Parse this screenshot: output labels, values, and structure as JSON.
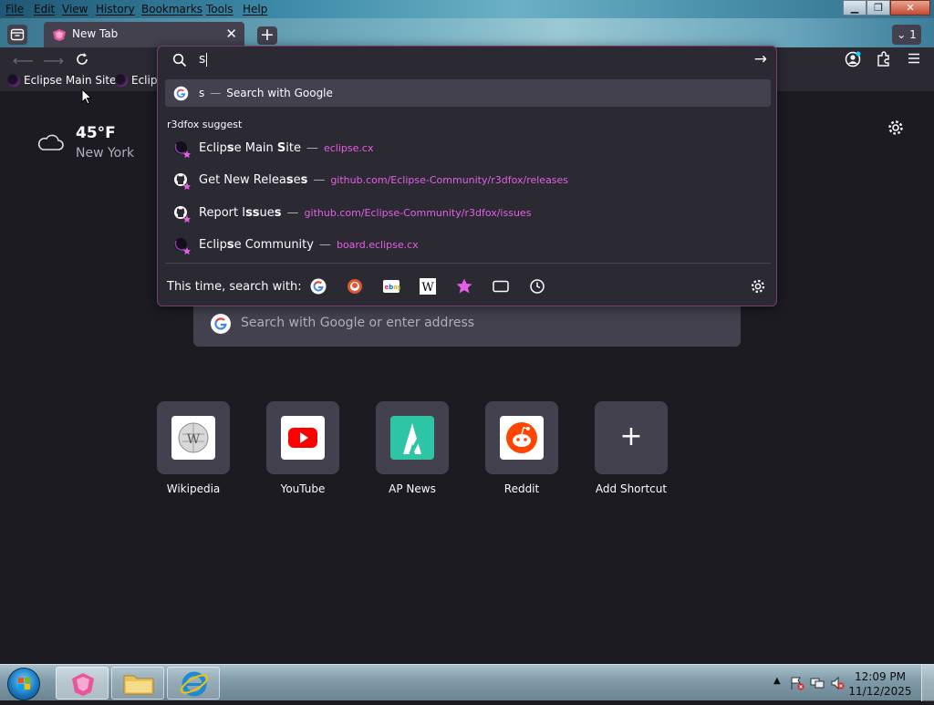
{
  "menu": [
    "File",
    "Edit",
    "View",
    "History",
    "Bookmarks",
    "Tools",
    "Help"
  ],
  "window_controls": {
    "minimize": "▁",
    "restore": "❐",
    "close": "✕"
  },
  "tab": {
    "title": "New Tab",
    "close": "✕"
  },
  "new_tab_label": "+",
  "tab_count": "1",
  "bookmarks": [
    "Eclipse Main Site",
    "Eclips"
  ],
  "weather": {
    "temp": "45°F",
    "location": "New York"
  },
  "search_placeholder": "Search with Google or enter address",
  "shortcuts": [
    {
      "label": "Wikipedia",
      "icon": "wikipedia-icon"
    },
    {
      "label": "YouTube",
      "icon": "youtube-icon"
    },
    {
      "label": "AP News",
      "icon": "apnews-icon"
    },
    {
      "label": "Reddit",
      "icon": "reddit-icon"
    },
    {
      "label": "Add Shortcut",
      "icon": "plus-icon",
      "glyph": "+"
    }
  ],
  "popup": {
    "query": "s",
    "search_row": {
      "query": "s",
      "sep": "—",
      "text": "Search with Google"
    },
    "suggest_heading": "r3dfox suggest",
    "results": [
      {
        "title_pre": "Eclip",
        "title_bold": "s",
        "title_post": "e Main ",
        "title_bold2": "S",
        "title_post2": "ite",
        "sep": "—",
        "url": "eclipse.cx",
        "icon": "eclipse-icon"
      },
      {
        "title_pre": "Get New Relea",
        "title_bold": "s",
        "title_post": "e",
        "title_bold2": "s",
        "title_post2": "",
        "sep": "—",
        "url": "github.com/Eclipse-Community/r3dfox/releases",
        "icon": "github-icon"
      },
      {
        "title_pre": "Report I",
        "title_bold": "ss",
        "title_post": "ue",
        "title_bold2": "s",
        "title_post2": "",
        "sep": "—",
        "url": "github.com/Eclipse-Community/r3dfox/issues",
        "icon": "github-icon"
      },
      {
        "title_pre": "Eclip",
        "title_bold": "s",
        "title_post": "e Community",
        "title_bold2": "",
        "title_post2": "",
        "sep": "—",
        "url": "board.eclipse.cx",
        "icon": "eclipse-icon"
      }
    ],
    "one_off_label": "This time, search with:",
    "one_off_engines": [
      "google-icon",
      "duckduckgo-icon",
      "ebay-icon",
      "wikipedia-w-icon",
      "bookmarks-star-icon",
      "tabs-icon",
      "history-clock-icon"
    ]
  },
  "clock": {
    "time": "12:09 PM",
    "date": "11/12/2025"
  },
  "colors": {
    "accent": "#e45ee8",
    "panel": "#2b2a33",
    "field": "#42414d",
    "background": "#1c1b22"
  }
}
